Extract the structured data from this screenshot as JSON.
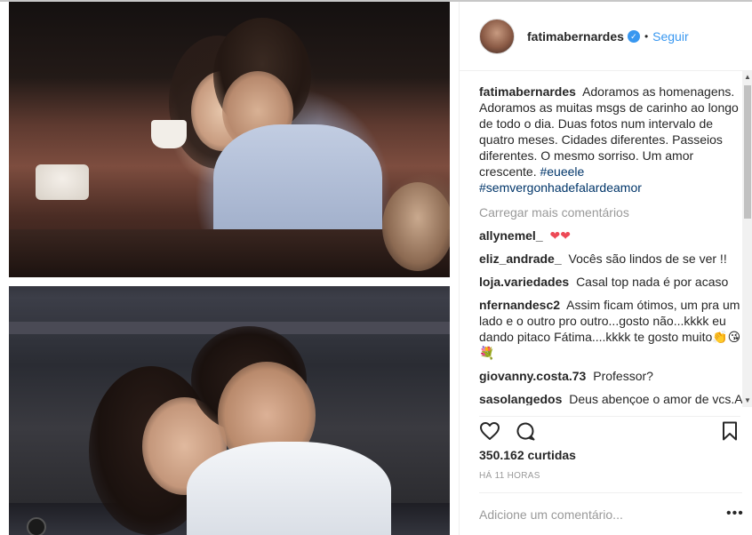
{
  "post": {
    "username": "fatimabernardes",
    "follow_label": "Seguir",
    "separator": "•",
    "caption_user": "fatimabernardes",
    "caption_text": "Adoramos as homenagens. Adoramos as muitas msgs de carinho ao longo de todo o dia. Duas fotos num intervalo de quatro meses. Cidades diferentes. Passeios diferentes. O mesmo sorriso. Um amor crescente.",
    "hashtags": [
      "#eueele",
      "#semvergonhadefalardeamor"
    ],
    "load_more_label": "Carregar mais comentários",
    "comments": [
      {
        "user": "allynemel_",
        "text": "❤❤"
      },
      {
        "user": "eliz_andrade_",
        "text": "Vocês são lindos de se ver !!"
      },
      {
        "user": "loja.variedades",
        "text": "Casal top nada é por acaso"
      },
      {
        "user": "nfernandesc2",
        "text": "Assim ficam ótimos, um pra um lado e o outro pro outro...gosto não...kkkk eu dando pitaco Fátima....kkkk te gosto muito👏😘💐"
      },
      {
        "user": "giovanny.costa.73",
        "text": "Professor?"
      },
      {
        "user": "sasolangedos",
        "text": "Deus abençoe o amor de vcs.A alegria é contagiante..Fátima vc ficou"
      }
    ],
    "likes": "350.162 curtidas",
    "timestamp": "HÁ 11 HORAS",
    "add_comment_placeholder": "Adicione um comentário...",
    "more_options": "•••"
  },
  "icons": {
    "verified": "verified-badge-icon",
    "like": "heart-outline-icon",
    "comment": "speech-bubble-icon",
    "save": "bookmark-icon",
    "more": "ellipsis-icon"
  },
  "colors": {
    "link_blue": "#3897f0",
    "hashtag": "#003569",
    "muted": "#999999",
    "heart": "#ed4956"
  }
}
